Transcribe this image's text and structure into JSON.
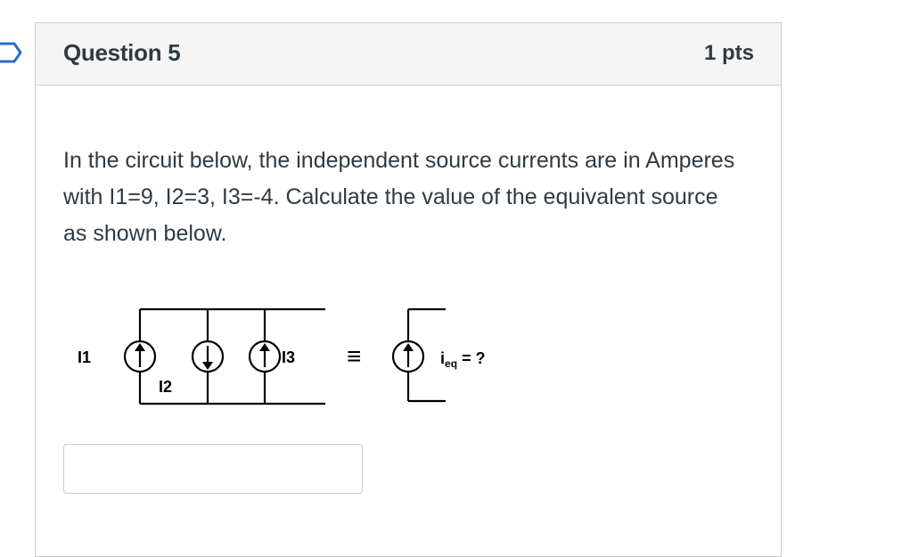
{
  "question": {
    "title": "Question 5",
    "points": "1 pts",
    "text": "In the circuit below, the independent source currents are in Amperes with I1=9,  I2=3, I3=-4. Calculate the value of the equivalent source as shown below.",
    "answer_value": "",
    "answer_placeholder": ""
  },
  "circuit": {
    "label_i1": "I1",
    "label_i2": "I2",
    "label_i3": "I3",
    "equiv_symbol": "≡",
    "ieq_main": "i",
    "ieq_sub": "eq",
    "ieq_rest": " = ?"
  },
  "colors": {
    "header_bg": "#f5f5f5",
    "border": "#c7cdd1",
    "text": "#2d3b45",
    "flag": "#2d6bc4"
  },
  "icons": {
    "flag": "flag-outline-icon"
  }
}
